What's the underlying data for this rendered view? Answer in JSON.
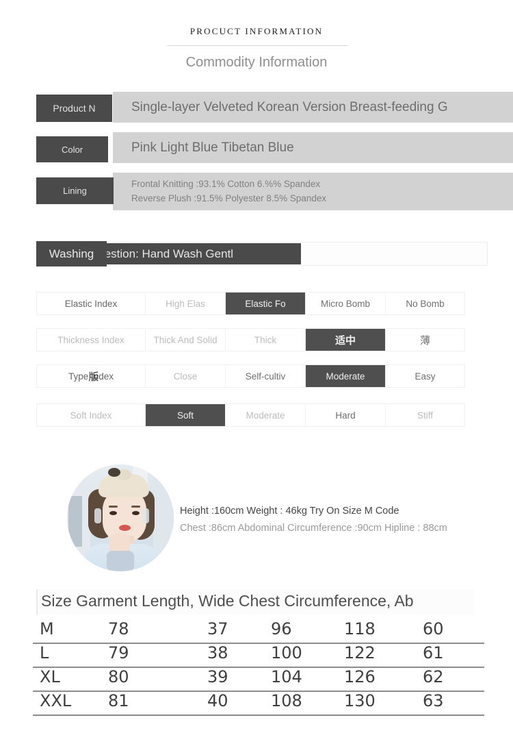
{
  "header": {
    "title": "PROCUCT INFORMATION",
    "subtitle": "Commodity Information"
  },
  "specs": {
    "product_name": {
      "label": "Product N",
      "value": "Single-layer  Velveted  Korean  Version  Breast-feeding G"
    },
    "color": {
      "label": "Color",
      "value": "Pink Light Blue Tibetan Blue"
    },
    "lining": {
      "label": "Lining",
      "line1": "Frontal Knitting :93.1% Cotton 6.%% Spandex",
      "line2": "Reverse Plush :91.5% Polyester 8.5% Spandex"
    }
  },
  "washing": {
    "label": "Washing",
    "value": "Suggestion: Hand  Wash Gentl"
  },
  "index_table": {
    "rows": [
      {
        "name": "elastic-index",
        "cells": [
          {
            "text": "Elastic Index",
            "state": "normal"
          },
          {
            "text": "High Elas",
            "state": "faint"
          },
          {
            "text": "Elastic Fo",
            "state": "selected"
          },
          {
            "text": "Micro Bomb",
            "state": "normal"
          },
          {
            "text": "No Bomb",
            "state": "normal"
          }
        ]
      },
      {
        "name": "thickness-index",
        "cells": [
          {
            "text": "Thickness Index",
            "state": "faint"
          },
          {
            "text": "Thick And Solid",
            "state": "faint"
          },
          {
            "text": "Thick",
            "state": "faint"
          },
          {
            "text": "适中",
            "state": "selected-cjk"
          },
          {
            "text": "薄",
            "state": "cjk"
          }
        ]
      },
      {
        "name": "type-index",
        "cells": [
          {
            "text": "Type Index",
            "state": "normal",
            "overlay_glyph": "版"
          },
          {
            "text": "Close",
            "state": "faint"
          },
          {
            "text": "Self-cultiv",
            "state": "normal"
          },
          {
            "text": "Moderate",
            "state": "selected"
          },
          {
            "text": "Easy",
            "state": "normal"
          }
        ]
      },
      {
        "name": "soft-index",
        "cells": [
          {
            "text": "Soft Index",
            "state": "faint"
          },
          {
            "text": "Soft",
            "state": "selected"
          },
          {
            "text": "Moderate",
            "state": "faint"
          },
          {
            "text": "Hard",
            "state": "normal"
          },
          {
            "text": "Stiff",
            "state": "faint"
          }
        ]
      }
    ]
  },
  "model": {
    "photo_alt": "model-portrait",
    "line1": "Height :160cm Weight : 46kg Try On Size M Code",
    "line2": "Chest :86cm Abdominal Circumference :90cm Hipline : 88cm"
  },
  "size_table": {
    "header": "Size Garment Length, Wide Chest Circumference, Ab",
    "rows": [
      {
        "size": "M",
        "values": [
          "78",
          "37",
          "96",
          "118",
          "60"
        ]
      },
      {
        "size": "L",
        "values": [
          "79",
          "38",
          "100",
          "122",
          "61"
        ]
      },
      {
        "size": "XL",
        "values": [
          "80",
          "39",
          "104",
          "126",
          "62"
        ]
      },
      {
        "size": "XXL",
        "values": [
          "81",
          "40",
          "108",
          "130",
          "63"
        ]
      }
    ]
  },
  "colors": {
    "dark_box": "#4a4a4a",
    "light_box": "#d2d2d2",
    "text_muted": "#8e8e8e"
  }
}
